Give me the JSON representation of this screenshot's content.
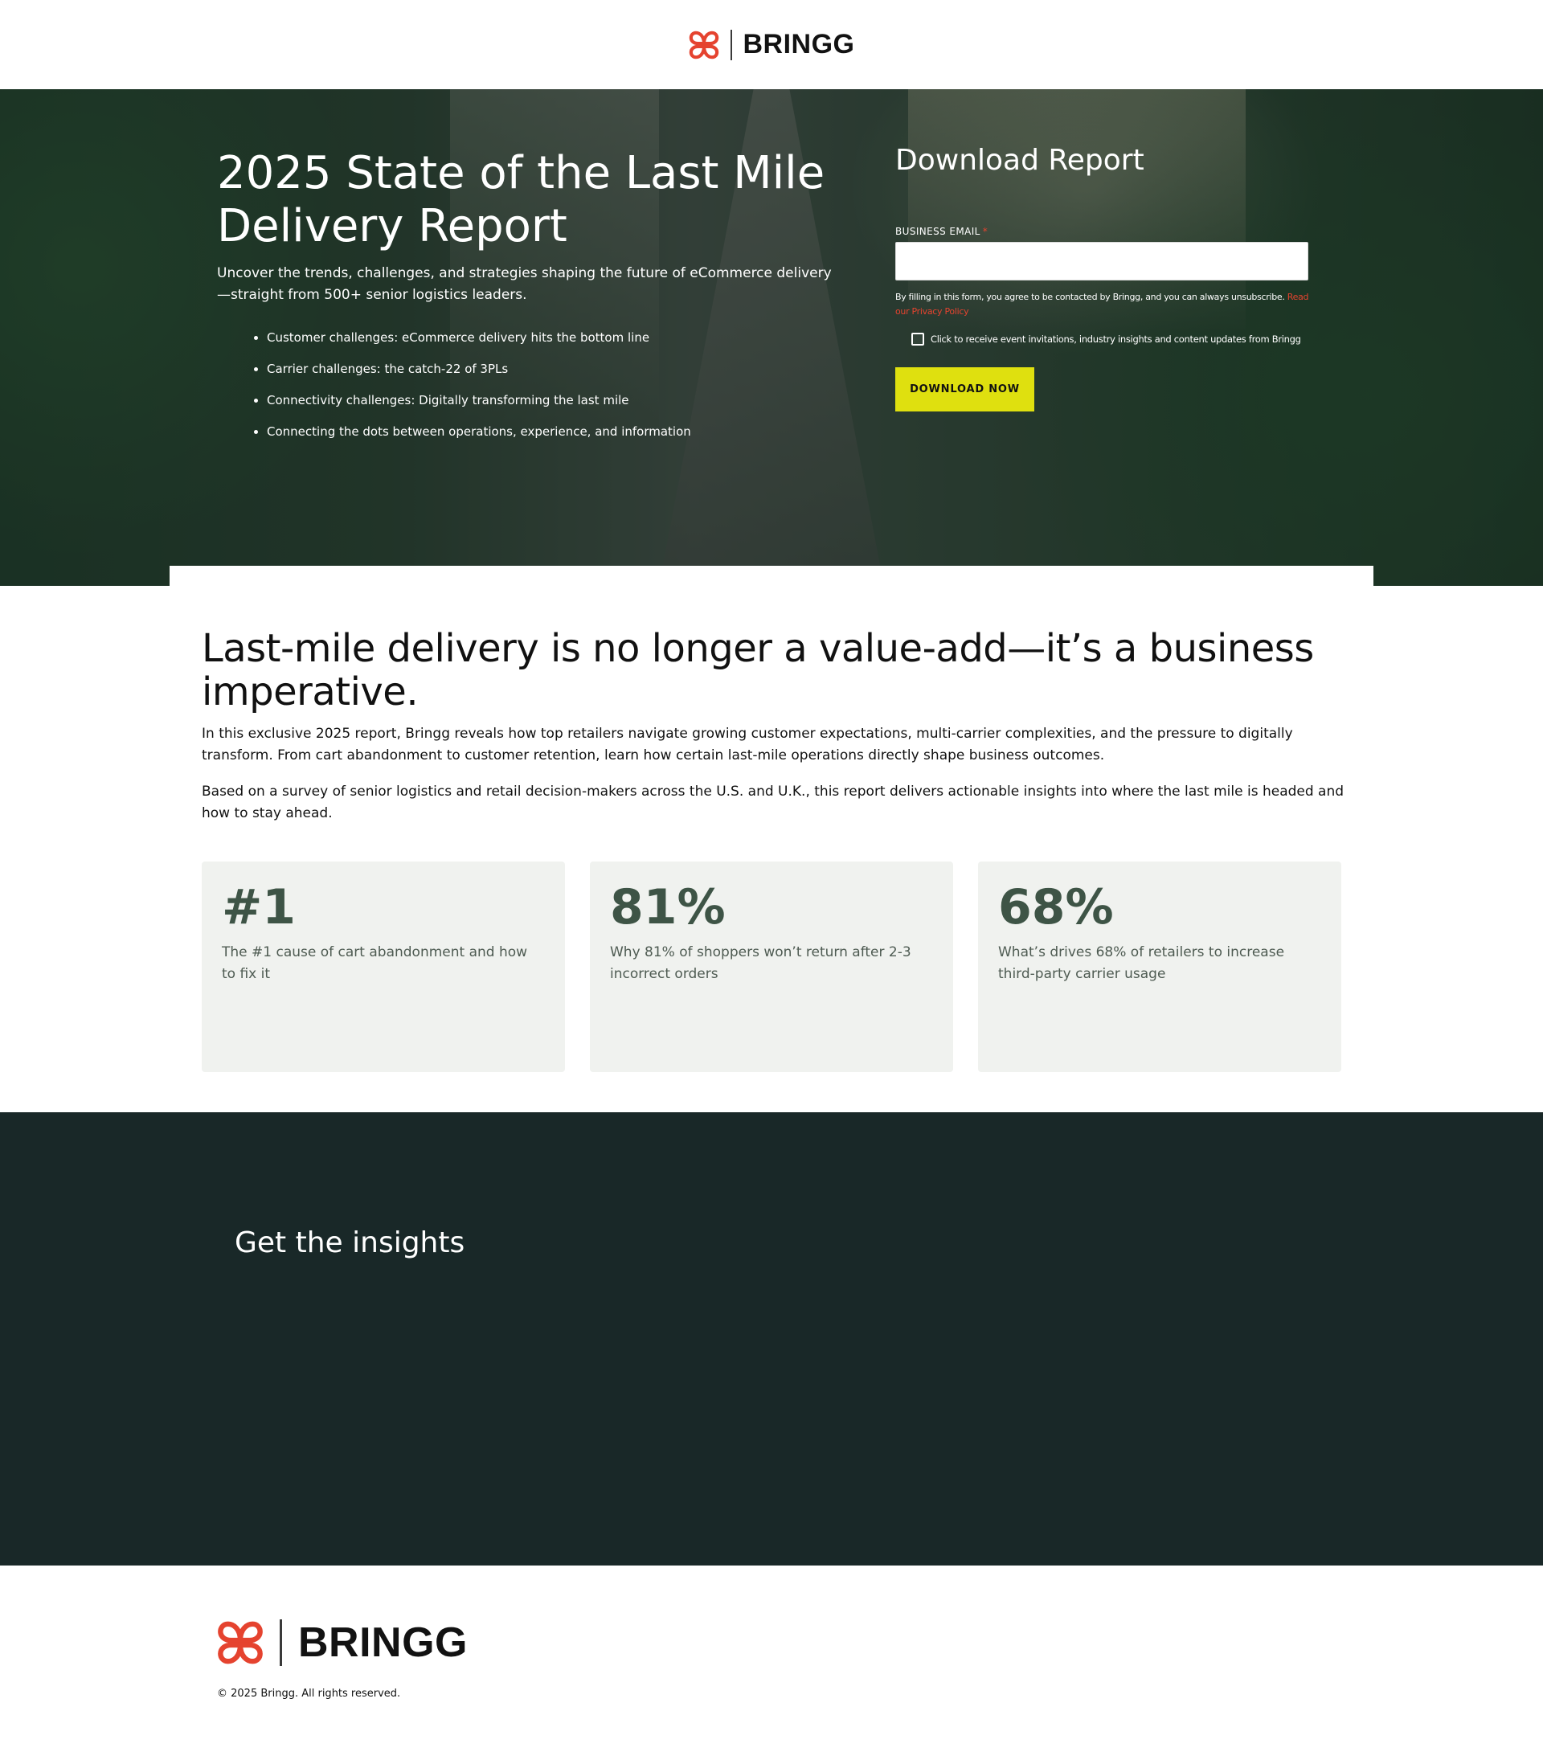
{
  "brand": {
    "name": "BRINGG",
    "logo_icon": "bringg-knot-icon",
    "accent_color": "#e5432f",
    "cta_color": "#dfe00f",
    "dark_section_color": "#192828"
  },
  "hero": {
    "title": "2025 State of the Last Mile Delivery Report",
    "subtitle": "Uncover the trends, challenges, and strategies shaping the future of eCommerce delivery—straight from 500+ senior logistics leaders.",
    "bullets": [
      "Customer challenges: eCommerce delivery hits the bottom line",
      "Carrier challenges: the catch-22 of 3PLs",
      "Connectivity challenges: Digitally transforming the last mile",
      "Connecting the dots between operations, experience, and information"
    ]
  },
  "form": {
    "title": "Download Report",
    "email_label": "BUSINESS EMAIL",
    "email_required_mark": "*",
    "email_value": "",
    "consent_text": "By filling in this form, you agree to be contacted by Bringg, and you can always unsubscribe. ",
    "privacy_link": "Read our Privacy Policy",
    "optin_label": "Click to receive event invitations, industry insights and content updates from Bringg",
    "optin_checked": false,
    "submit_label": "DOWNLOAD NOW"
  },
  "content": {
    "title": "Last-mile delivery is no longer a value-add—it’s a business imperative.",
    "paragraph_1": "In this exclusive 2025 report, Bringg reveals how top retailers navigate growing customer expectations, multi-carrier complexities, and the pressure to digitally transform. From cart abandonment to customer retention, learn how certain last-mile operations directly shape business outcomes.",
    "paragraph_2": "Based on a survey of senior logistics and retail decision-makers across the U.S. and U.K., this report delivers actionable insights into where the last mile is headed and how to stay ahead.",
    "stats": [
      {
        "value": "#1",
        "text": "The #1 cause of cart abandonment and how to fix it"
      },
      {
        "value": "81%",
        "text": "Why 81% of shoppers won’t return after 2-3 incorrect orders"
      },
      {
        "value": "68%",
        "text": "What’s drives 68% of retailers to increase third-party carrier usage"
      }
    ]
  },
  "insights": {
    "title": "Get the insights"
  },
  "footer": {
    "copyright": "© 2025 Bringg. All rights reserved."
  }
}
